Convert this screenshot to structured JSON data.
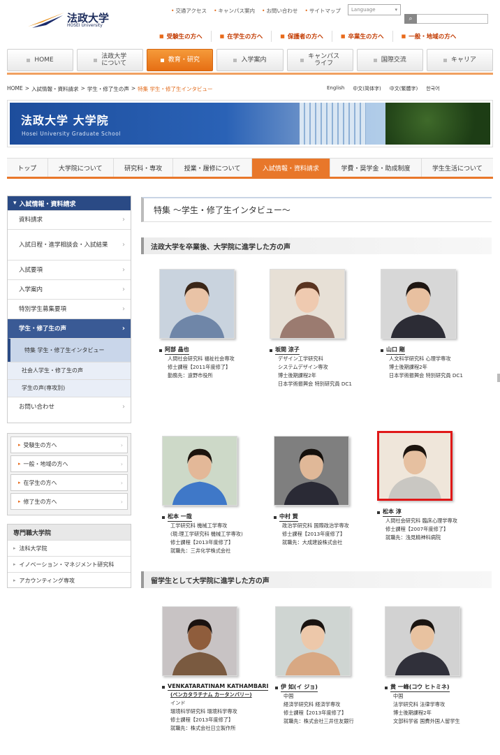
{
  "header": {
    "logo_text": "法政大学",
    "logo_sub": "HOSEI University",
    "utility_links": [
      "交通アクセス",
      "キャンパス案内",
      "お問い合わせ",
      "サイトマップ"
    ],
    "language_select": "Language",
    "audience_links": [
      "受験生の方へ",
      "在学生の方へ",
      "保護者の方へ",
      "卒業生の方へ",
      "一般・地域の方へ"
    ]
  },
  "global_nav": [
    {
      "label": "HOME"
    },
    {
      "label": "法政大学\nについて"
    },
    {
      "label": "教育・研究",
      "active": true
    },
    {
      "label": "入学案内"
    },
    {
      "label": "キャンパス\nライフ"
    },
    {
      "label": "国際交流"
    },
    {
      "label": "キャリア"
    }
  ],
  "breadcrumb": [
    "HOME",
    "入試情報・資料請求",
    "学生・修了生の声",
    "特集 学生・修了生インタビュー"
  ],
  "lang_links": [
    "English",
    "中文(简体字)",
    "中文(繁體字)",
    "한국어"
  ],
  "banner": {
    "title": "法政大学 大学院",
    "subtitle": "Hosei University Graduate School"
  },
  "sub_nav": [
    {
      "label": "トップ"
    },
    {
      "label": "大学院について"
    },
    {
      "label": "研究科・専攻"
    },
    {
      "label": "授業・履修について"
    },
    {
      "label": "入試情報・資料請求",
      "active": true
    },
    {
      "label": "学費・奨学金・助成制度"
    },
    {
      "label": "学生生活について"
    }
  ],
  "sidebar": {
    "heading": "入試情報・資料請求",
    "items": [
      {
        "label": "資料請求"
      },
      {
        "label": "入試日程・進学相談会・入試結果"
      },
      {
        "label": "入試要項"
      },
      {
        "label": "入学案内"
      },
      {
        "label": "特別学生募集要項"
      },
      {
        "label": "学生・修了生の声",
        "type": "activehead"
      },
      {
        "label": "特集 学生・修了生インタビュー",
        "type": "sub-selected"
      },
      {
        "label": "社会人学生・修了生の声",
        "type": "sub"
      },
      {
        "label": "学生の声(専攻別)",
        "type": "sub"
      },
      {
        "label": "お問い合わせ"
      }
    ],
    "audience_buttons": [
      "受験生の方へ",
      "一般・地域の方へ",
      "在学生の方へ",
      "修了生の方へ"
    ],
    "professional": {
      "heading": "専門職大学院",
      "items": [
        "法科大学院",
        "イノベーション・マネジメント研究科",
        "アカウンティング専攻"
      ]
    }
  },
  "main": {
    "page_title": "特集 〜学生・修了生インタビュー〜",
    "section1_title": "法政大学を卒業後、大学院に進学した方の声",
    "section2_title": "留学生として大学院に進学した方の声",
    "section1_people": [
      {
        "name": "阿部 晶也",
        "lines": [
          "人間社会研究科 福祉社会専攻",
          "修士課程【2011年度修了】",
          "勤務先：遠野市役所"
        ]
      },
      {
        "name": "坂間 涼子",
        "lines": [
          "デザイン工学研究科",
          "システムデザイン専攻",
          "博士後期課程2年",
          "日本学術振興会 特別研究員 DC1"
        ]
      },
      {
        "name": "山口 剛",
        "lines": [
          "人文科学研究科 心理学専攻",
          "博士後期課程2年",
          "日本学術振興会 特別研究員 DC1"
        ]
      },
      {
        "name": "松本 一哉",
        "lines": [
          "工学研究科 機械工学専攻",
          "(現:理工学研究科 機械工学専攻)",
          "修士課程【2013年度修了】",
          "就職先：三井化学株式会社"
        ]
      },
      {
        "name": "中村 賢",
        "lines": [
          "政治学研究科 国際政治学専攻",
          "修士課程【2013年度修了】",
          "就職先：大成建設株式会社"
        ]
      },
      {
        "name": "松本 淳",
        "lines": [
          "人間社会研究科 臨床心理学専攻",
          "修士課程【2007年度修了】",
          "就職先：浅見精神科病院"
        ]
      }
    ],
    "section2_people": [
      {
        "name": "VENKATARATINAM KATHAMBARI",
        "name2": "(ベンカタラチナム カータンバリー)",
        "lines": [
          "インド",
          "環境科学研究科 環境科学専攻",
          "修士課程【2013年度修了】",
          "就職先：株式会社日立製作所"
        ]
      },
      {
        "name": "伊 如(イ ジョ)",
        "lines": [
          "中国",
          "経済学研究科 経済学専攻",
          "修士課程【2013年度修了】",
          "就職先：株式会社三井住友銀行"
        ]
      },
      {
        "name": "黄 一峰(コウ ヒトミネ)",
        "lines": [
          "中国",
          "法学研究科 法律学専攻",
          "博士後期課程2年",
          "文部科学省 国費外国人留学生"
        ]
      }
    ]
  },
  "colors": {
    "accent_orange": "#e8772a",
    "navy": "#2a4a85",
    "highlight_border": "#e01818"
  }
}
